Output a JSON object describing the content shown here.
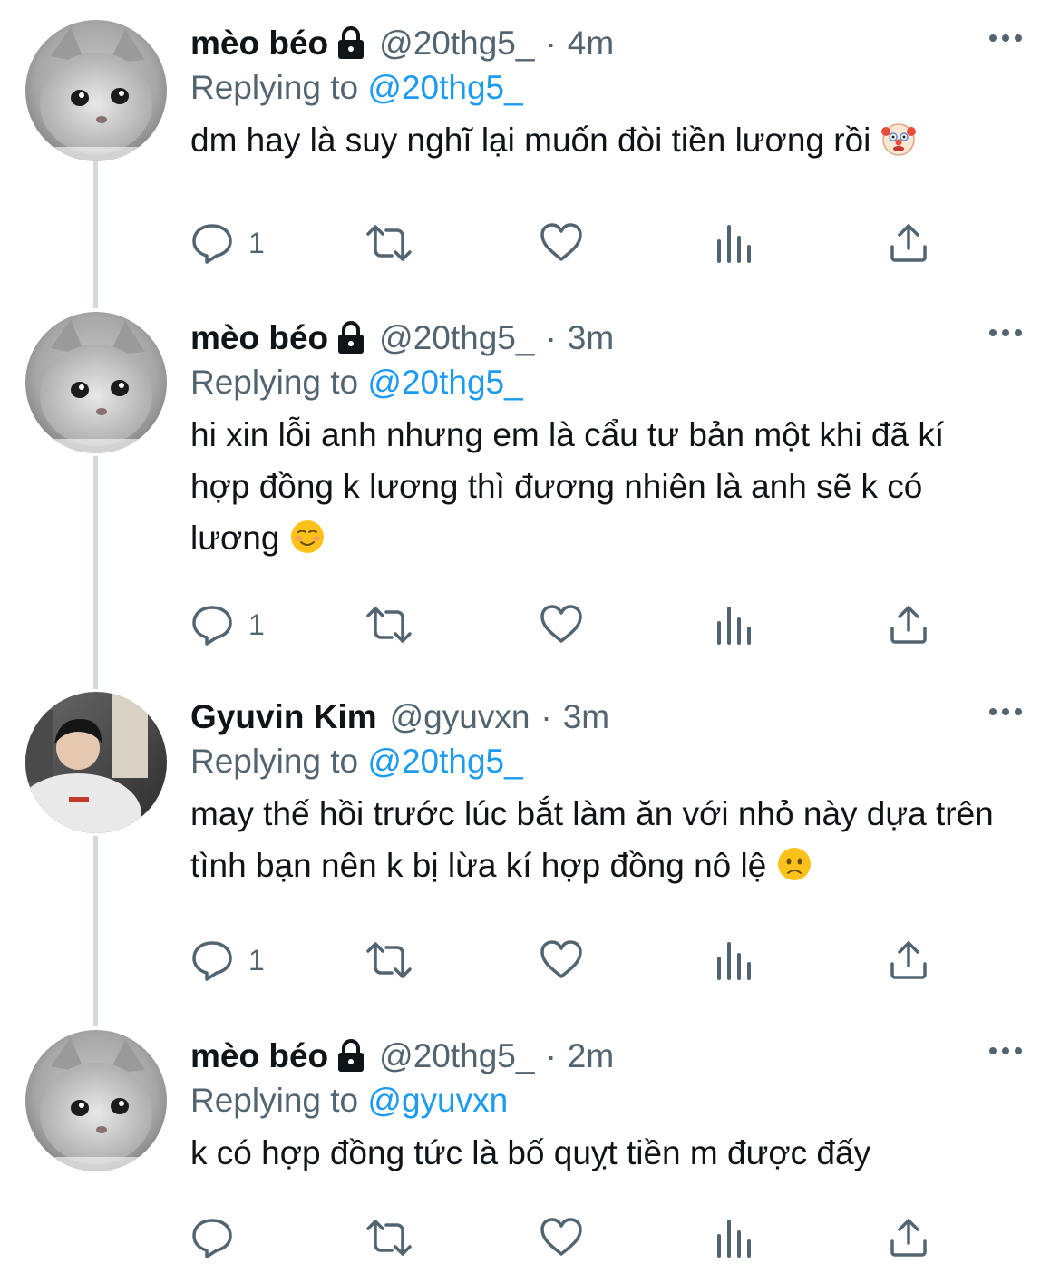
{
  "tweets": [
    {
      "display_name": "mèo béo",
      "handle": "@20thg5_",
      "separator": "·",
      "time": "4m",
      "replying_label": "Replying to",
      "replying_to": "@20thg5_",
      "text": "dm hay là suy nghĩ lại muốn đòi tiền lương rồi",
      "emoji": "clown-face",
      "reply_count": "1",
      "avatar": "kitten"
    },
    {
      "display_name": "mèo béo",
      "handle": "@20thg5_",
      "separator": "·",
      "time": "3m",
      "replying_label": "Replying to",
      "replying_to": "@20thg5_",
      "text": "hi xin lỗi anh nhưng em là cẩu tư bản một khi đã kí hợp đồng k lương thì đương nhiên là anh sẽ k có lương",
      "emoji": "smiling-face",
      "reply_count": "1",
      "avatar": "kitten"
    },
    {
      "display_name": "Gyuvin Kim",
      "handle": "@gyuvxn",
      "separator": "·",
      "time": "3m",
      "replying_label": "Replying to",
      "replying_to": "@20thg5_",
      "text": "may thế hồi trước lúc bắt làm ăn với nhỏ này dựa trên tình bạn nên k bị lừa kí hợp đồng nô lệ",
      "emoji": "worried-face",
      "reply_count": "1",
      "avatar": "person-photo"
    },
    {
      "display_name": "mèo béo",
      "handle": "@20thg5_",
      "separator": "·",
      "time": "2m",
      "replying_label": "Replying to",
      "replying_to": "@gyuvxn",
      "text": "k có hợp đồng tức là bố quỵt tiền m được đấy",
      "emoji": "",
      "reply_count": "",
      "avatar": "kitten"
    }
  ],
  "colors": {
    "text": "#0f1419",
    "secondary": "#536471",
    "link": "#1d9bf0",
    "thread_line": "#cfd9de"
  }
}
